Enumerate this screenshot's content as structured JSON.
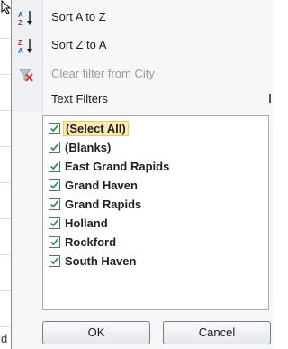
{
  "sheet": {
    "cell_letter": "d"
  },
  "menu": {
    "items": [
      {
        "icon": "sort-a-to-z-icon",
        "label": "Sort A to Z",
        "enabled": true
      },
      {
        "icon": "sort-z-to-a-icon",
        "label": "Sort Z to A",
        "enabled": true
      },
      {
        "icon": "clear-filter-icon",
        "label": "Clear filter from City",
        "enabled": false
      },
      {
        "icon": "",
        "label": "Text Filters",
        "enabled": true,
        "has_submenu": true
      }
    ]
  },
  "filter_list": {
    "items": [
      {
        "label": "(Select All)",
        "checked": true,
        "highlighted": true
      },
      {
        "label": "(Blanks)",
        "checked": true
      },
      {
        "label": "East Grand Rapids",
        "checked": true
      },
      {
        "label": "Grand Haven",
        "checked": true
      },
      {
        "label": "Grand Rapids",
        "checked": true
      },
      {
        "label": "Holland",
        "checked": true
      },
      {
        "label": "Rockford",
        "checked": true
      },
      {
        "label": "South Haven",
        "checked": true
      }
    ]
  },
  "buttons": {
    "ok": "OK",
    "cancel": "Cancel"
  },
  "colors": {
    "checkmark": "#2b8a3e",
    "highlight": "#fce9b8",
    "clear_filter_icon": "#d9342b"
  }
}
